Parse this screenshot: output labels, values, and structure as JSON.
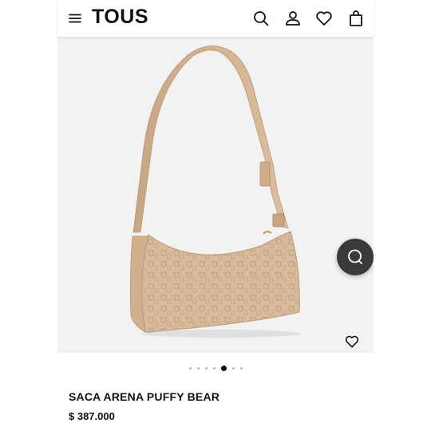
{
  "header": {
    "logo": "TOUS",
    "icons": [
      "menu-icon",
      "search-icon",
      "user-icon",
      "heart-icon",
      "shopping-bag-icon"
    ]
  },
  "gallery": {
    "slide_count": 7,
    "active_slide_index": 4,
    "chat_icon": "chat-icon",
    "wishlist_icon": "heart-outline-icon"
  },
  "product": {
    "name": "SACA ARENA PUFFY BEAR",
    "price": "$ 387.000"
  },
  "colors": {
    "gallery_background": "#f2f2f2",
    "bag": "#d6b796",
    "chat_button": "#3a3a3a",
    "active_dot": "#111111",
    "inactive_dot": "#b8b8b8"
  }
}
